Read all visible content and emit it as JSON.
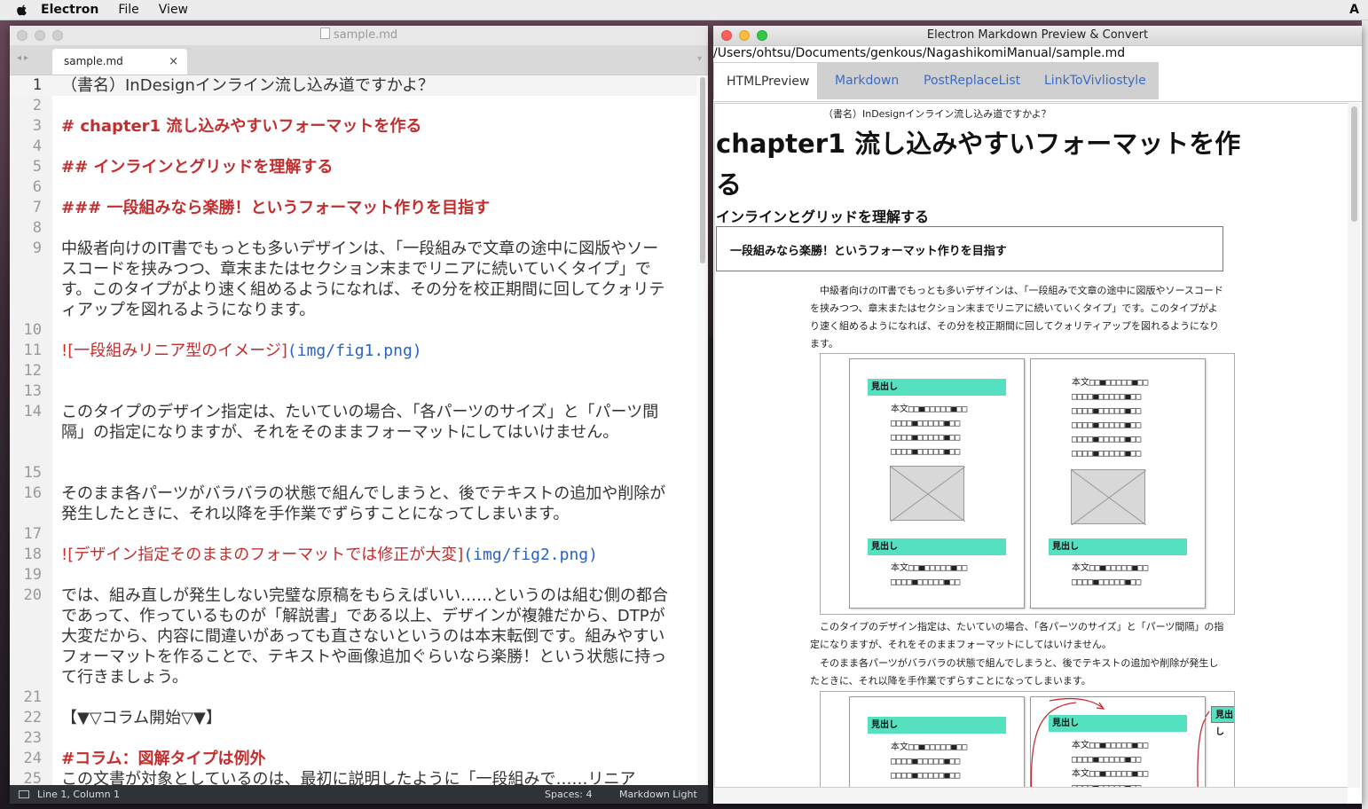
{
  "menubar": {
    "app": "Electron",
    "file": "File",
    "view": "View",
    "right": "A"
  },
  "editor": {
    "title": "sample.md",
    "tab_label": "sample.md",
    "tab_close": "×",
    "nav": "◂▸",
    "drop": "▾",
    "lines": [
      {
        "n": "1",
        "text": "（書名）InDesignインライン流し込み道ですかよ？"
      },
      {
        "n": "2",
        "text": ""
      },
      {
        "n": "3",
        "text": "# chapter1 流し込みやすいフォーマットを作る"
      },
      {
        "n": "4",
        "text": ""
      },
      {
        "n": "5",
        "text": "## インラインとグリッドを理解する"
      },
      {
        "n": "6",
        "text": ""
      },
      {
        "n": "7",
        "text": "### 一段組みなら楽勝！というフォーマット作りを目指す"
      },
      {
        "n": "8",
        "text": ""
      },
      {
        "n": "9",
        "text": "中級者向けのIT書でもっとも多いデザインは、「一段組みで文章の途中に図版やソースコードを挟みつつ、章末またはセクション末までリニアに続いていくタイプ」です。このタイプがより速く組めるようになれば、その分を校正期間に回してクォリティアップを図れるようになります。"
      },
      {
        "n": "10",
        "text": ""
      },
      {
        "n": "11",
        "bang": "!",
        "alt": "[一段組みリニア型のイメージ]",
        "url": "(img/fig1.png)"
      },
      {
        "n": "12",
        "text": ""
      },
      {
        "n": "13",
        "text": ""
      },
      {
        "n": "14",
        "text": "このタイプのデザイン指定は、たいていの場合、「各パーツのサイズ」と「パーツ間隔」の指定になりますが、それをそのままフォーマットにしてはいけません。"
      },
      {
        "n": "15",
        "text": ""
      },
      {
        "n": "16",
        "text": "そのまま各パーツがバラバラの状態で組んでしまうと、後でテキストの追加や削除が発生したときに、それ以降を手作業でずらすことになってしまいます。"
      },
      {
        "n": "17",
        "text": ""
      },
      {
        "n": "18",
        "bang": "!",
        "alt": "[デザイン指定そのままのフォーマットでは修正が大変]",
        "url": "(img/fig2.png)"
      },
      {
        "n": "19",
        "text": ""
      },
      {
        "n": "20",
        "text": "では、組み直しが発生しない完璧な原稿をもらえばいい……というのは組む側の都合であって、作っているものが「解説書」である以上、デザインが複雑だから、DTPが大変だから、内容に間違いがあっても直さないというのは本末転倒です。組みやすいフォーマットを作ることで、テキストや画像追加ぐらいなら楽勝！という状態に持って行きましょう。"
      },
      {
        "n": "21",
        "text": ""
      },
      {
        "n": "22",
        "text": "【▼▽コラム開始▽▼】"
      },
      {
        "n": "23",
        "text": ""
      },
      {
        "n": "24",
        "text": "#コラム：図解タイプは例外"
      },
      {
        "n": "25",
        "text": "この文書が対象としているのは、最初に説明したように「一段組みで……リニア"
      }
    ],
    "status": {
      "position": "Line 1, Column 1",
      "spaces": "Spaces: 4",
      "syntax": "Markdown Light"
    }
  },
  "preview": {
    "title": "Electron Markdown Preview & Convert",
    "path": "/Users/ohtsu/Documents/genkous/NagashikomiManual/sample.md",
    "tabs": [
      "HTMLPreview",
      "Markdown",
      "PostReplaceList",
      "LinkToVivliostyle"
    ],
    "book_title": "（書名）InDesignインライン流し込み道ですかよ？",
    "h1": "chapter1 流し込みやすいフォーマットを作る",
    "h2": "インラインとグリッドを理解する",
    "h3": "一段組みなら楽勝！というフォーマット作りを目指す",
    "p1": "中級者向けのIT書でもっとも多いデザインは、「一段組みで文章の途中に図版やソースコードを挟みつつ、章末またはセクション末までリニアに続いていくタイプ」です。このタイプがより速く組めるようになれば、その分を校正期間に回してクォリティアップを図れるようになります。",
    "p2": "このタイプのデザイン指定は、たいていの場合、「各パーツのサイズ」と「パーツ間隔」の指定になりますが、それをそのままフォーマットにしてはいけません。",
    "p3": "そのまま各パーツがバラバラの状態で組んでしまうと、後でテキストの追加や削除が発生したときに、それ以降を手作業でずらすことになってしまいます。",
    "fig": {
      "heading": "見出し",
      "row_a": "本文□□■□□□□□■□□",
      "row_b": "□□□□■□□□□□■□□",
      "row_c": "□□□□■□□□□□■□□"
    }
  }
}
